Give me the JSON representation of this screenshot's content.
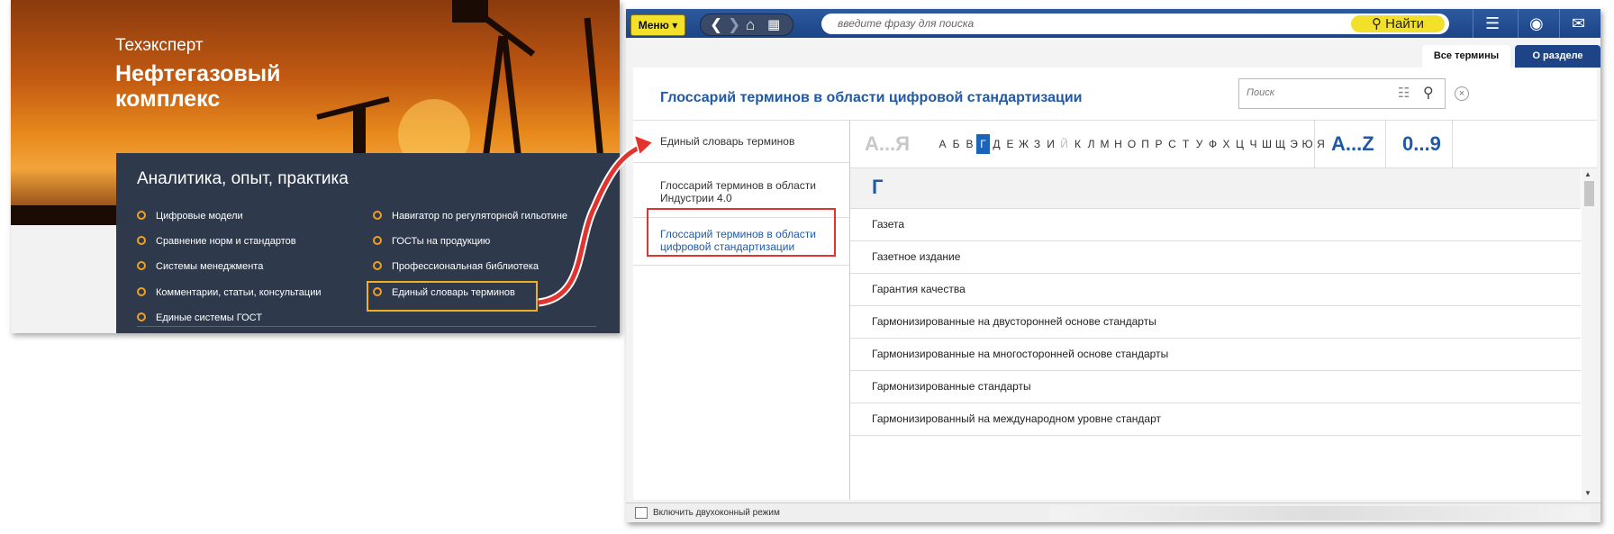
{
  "left_panel": {
    "brand_small": "Техэксперт",
    "brand_big": "Нефтегазовый комплекс",
    "section_title": "Аналитика, опыт, практика",
    "links_col1": [
      "Цифровые модели",
      "Сравнение норм и стандартов",
      "Системы менеджмента",
      "Комментарии, статьи, консультации",
      "Единые системы ГОСТ"
    ],
    "links_col2": [
      "Навигатор по регуляторной гильотине",
      "ГОСТы на продукцию",
      "Профессиональная библиотека",
      "Единый словарь терминов"
    ]
  },
  "window": {
    "menu_label": "Меню",
    "search_placeholder": "введите фразу для поиска",
    "find_label": "Найти",
    "tabs": [
      "Все термины",
      "О разделе"
    ],
    "title": "Глоссарий терминов в области цифровой стандартизации",
    "card_search_placeholder": "Поиск",
    "sidebar": [
      "Единый словарь терминов",
      "Глоссарий терминов в области Индустрии 4.0",
      "Глоссарий терминов в области цифровой стандартизации"
    ],
    "alphabet": {
      "ru_range": "А...Я",
      "letters": [
        "А",
        "Б",
        "В",
        "Г",
        "Д",
        "Е",
        "Ж",
        "З",
        "И",
        "Й",
        "К",
        "Л",
        "М",
        "Н",
        "О",
        "П",
        "Р",
        "С",
        "Т",
        "У",
        "Ф",
        "Х",
        "Ц",
        "Ч",
        "Ш",
        "Щ",
        "Э",
        "Ю",
        "Я"
      ],
      "selected": "Г",
      "disabled": [
        "Й"
      ],
      "en_range": "A...Z",
      "num_range": "0...9"
    },
    "current_letter": "Г",
    "terms": [
      "Газета",
      "Газетное издание",
      "Гарантия качества",
      "Гармонизированные на двусторонней основе стандарты",
      "Гармонизированные на многосторонней основе стандарты",
      "Гармонизированные стандарты",
      "Гармонизированный на международном уровне стандарт"
    ],
    "status_text": "Включить двухоконный режим"
  },
  "colors": {
    "accent_blue": "#2059a8",
    "top_bar": "#1c4487",
    "highlight_red": "#e2332f",
    "menu_yellow": "#f3e02a",
    "panel_dark": "#2e3a4c"
  }
}
